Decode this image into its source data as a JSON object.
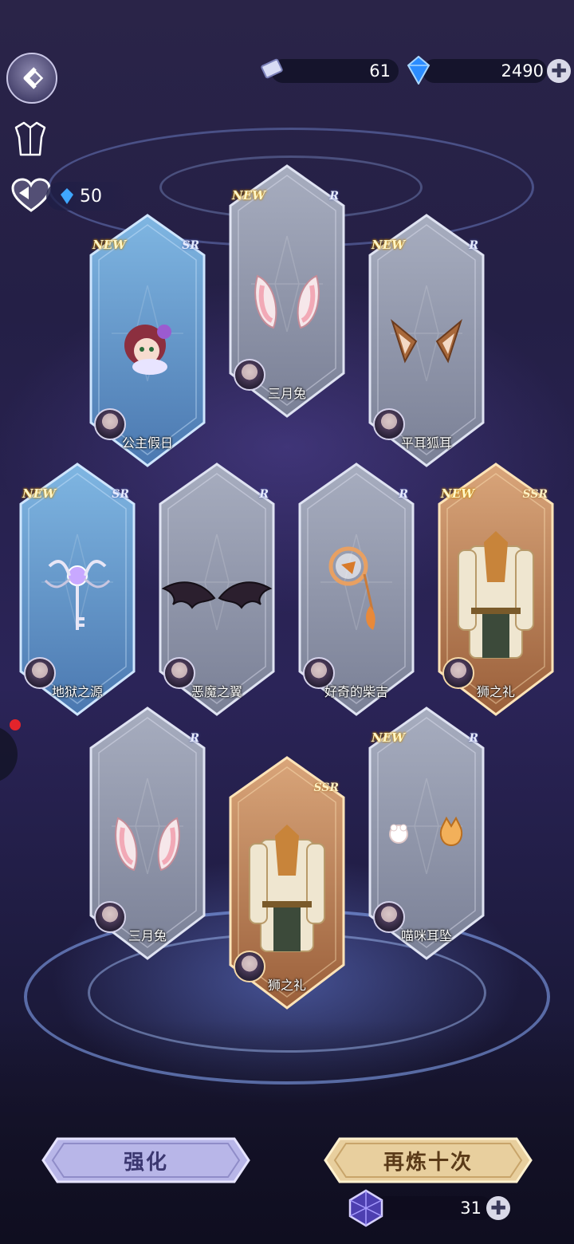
{
  "currencies": {
    "tickets": "61",
    "gems": "2490",
    "heart_gems": "50",
    "crystals": "31"
  },
  "cards": [
    {
      "name": "公主假日",
      "rarity": "SR",
      "new": "NEW",
      "kind": "sr",
      "item": "doll"
    },
    {
      "name": "三月兔",
      "rarity": "R",
      "new": "NEW",
      "kind": "r",
      "item": "bunny-ears"
    },
    {
      "name": "平耳狐耳",
      "rarity": "R",
      "new": "NEW",
      "kind": "r",
      "item": "fox-ears"
    },
    {
      "name": "地狱之源",
      "rarity": "SR",
      "new": "NEW",
      "kind": "sr",
      "item": "key"
    },
    {
      "name": "恶魔之翼",
      "rarity": "R",
      "new": "",
      "kind": "r",
      "item": "wings"
    },
    {
      "name": "好奇的柴吉",
      "rarity": "R",
      "new": "",
      "kind": "r",
      "item": "magnifier"
    },
    {
      "name": "狮之礼",
      "rarity": "SSR",
      "new": "NEW",
      "kind": "ssr",
      "item": "coat"
    },
    {
      "name": "三月兔",
      "rarity": "R",
      "new": "",
      "kind": "r",
      "item": "bunny-ears"
    },
    {
      "name": "狮之礼",
      "rarity": "SSR",
      "new": "",
      "kind": "ssr",
      "item": "coat"
    },
    {
      "name": "喵咪耳坠",
      "rarity": "R",
      "new": "NEW",
      "kind": "r",
      "item": "earrings"
    }
  ],
  "buttons": {
    "enhance": "强化",
    "refine_ten": "再炼十次"
  },
  "icons": [
    "back-icon",
    "outfit-icon",
    "heart-icon",
    "ticket-icon",
    "gem-icon",
    "crystal-icon",
    "plus-icon"
  ],
  "colors": {
    "r_frame": "#9aa0b2",
    "sr_frame": "#6fa8d8",
    "ssr_frame": "#c88a5a",
    "new_tag": "#fff6c8"
  }
}
